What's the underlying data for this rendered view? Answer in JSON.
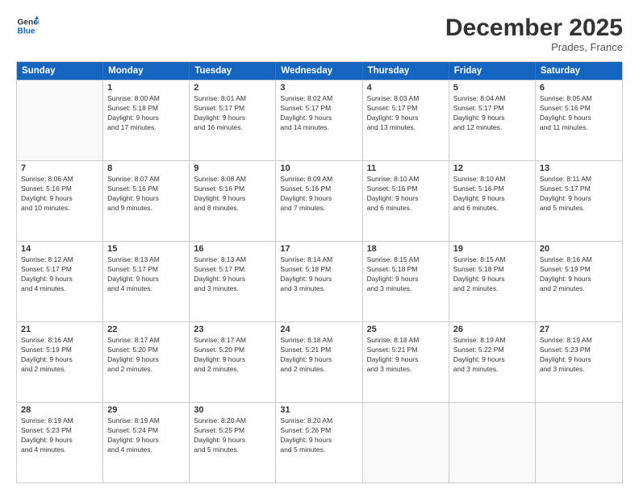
{
  "header": {
    "logo_line1": "General",
    "logo_line2": "Blue",
    "month": "December 2025",
    "location": "Prades, France"
  },
  "days_of_week": [
    "Sunday",
    "Monday",
    "Tuesday",
    "Wednesday",
    "Thursday",
    "Friday",
    "Saturday"
  ],
  "weeks": [
    [
      {
        "day": "",
        "info": ""
      },
      {
        "day": "1",
        "info": "Sunrise: 8:00 AM\nSunset: 5:18 PM\nDaylight: 9 hours\nand 17 minutes."
      },
      {
        "day": "2",
        "info": "Sunrise: 8:01 AM\nSunset: 5:17 PM\nDaylight: 9 hours\nand 16 minutes."
      },
      {
        "day": "3",
        "info": "Sunrise: 8:02 AM\nSunset: 5:17 PM\nDaylight: 9 hours\nand 14 minutes."
      },
      {
        "day": "4",
        "info": "Sunrise: 8:03 AM\nSunset: 5:17 PM\nDaylight: 9 hours\nand 13 minutes."
      },
      {
        "day": "5",
        "info": "Sunrise: 8:04 AM\nSunset: 5:17 PM\nDaylight: 9 hours\nand 12 minutes."
      },
      {
        "day": "6",
        "info": "Sunrise: 8:05 AM\nSunset: 5:16 PM\nDaylight: 9 hours\nand 11 minutes."
      }
    ],
    [
      {
        "day": "7",
        "info": "Sunrise: 8:06 AM\nSunset: 5:16 PM\nDaylight: 9 hours\nand 10 minutes."
      },
      {
        "day": "8",
        "info": "Sunrise: 8:07 AM\nSunset: 5:16 PM\nDaylight: 9 hours\nand 9 minutes."
      },
      {
        "day": "9",
        "info": "Sunrise: 8:08 AM\nSunset: 5:16 PM\nDaylight: 9 hours\nand 8 minutes."
      },
      {
        "day": "10",
        "info": "Sunrise: 8:09 AM\nSunset: 5:16 PM\nDaylight: 9 hours\nand 7 minutes."
      },
      {
        "day": "11",
        "info": "Sunrise: 8:10 AM\nSunset: 5:16 PM\nDaylight: 9 hours\nand 6 minutes."
      },
      {
        "day": "12",
        "info": "Sunrise: 8:10 AM\nSunset: 5:16 PM\nDaylight: 9 hours\nand 6 minutes."
      },
      {
        "day": "13",
        "info": "Sunrise: 8:11 AM\nSunset: 5:17 PM\nDaylight: 9 hours\nand 5 minutes."
      }
    ],
    [
      {
        "day": "14",
        "info": "Sunrise: 8:12 AM\nSunset: 5:17 PM\nDaylight: 9 hours\nand 4 minutes."
      },
      {
        "day": "15",
        "info": "Sunrise: 8:13 AM\nSunset: 5:17 PM\nDaylight: 9 hours\nand 4 minutes."
      },
      {
        "day": "16",
        "info": "Sunrise: 8:13 AM\nSunset: 5:17 PM\nDaylight: 9 hours\nand 3 minutes."
      },
      {
        "day": "17",
        "info": "Sunrise: 8:14 AM\nSunset: 5:18 PM\nDaylight: 9 hours\nand 3 minutes."
      },
      {
        "day": "18",
        "info": "Sunrise: 8:15 AM\nSunset: 5:18 PM\nDaylight: 9 hours\nand 3 minutes."
      },
      {
        "day": "19",
        "info": "Sunrise: 8:15 AM\nSunset: 5:18 PM\nDaylight: 9 hours\nand 2 minutes."
      },
      {
        "day": "20",
        "info": "Sunrise: 8:16 AM\nSunset: 5:19 PM\nDaylight: 9 hours\nand 2 minutes."
      }
    ],
    [
      {
        "day": "21",
        "info": "Sunrise: 8:16 AM\nSunset: 5:19 PM\nDaylight: 9 hours\nand 2 minutes."
      },
      {
        "day": "22",
        "info": "Sunrise: 8:17 AM\nSunset: 5:20 PM\nDaylight: 9 hours\nand 2 minutes."
      },
      {
        "day": "23",
        "info": "Sunrise: 8:17 AM\nSunset: 5:20 PM\nDaylight: 9 hours\nand 2 minutes."
      },
      {
        "day": "24",
        "info": "Sunrise: 8:18 AM\nSunset: 5:21 PM\nDaylight: 9 hours\nand 2 minutes."
      },
      {
        "day": "25",
        "info": "Sunrise: 8:18 AM\nSunset: 5:21 PM\nDaylight: 9 hours\nand 3 minutes."
      },
      {
        "day": "26",
        "info": "Sunrise: 8:19 AM\nSunset: 5:22 PM\nDaylight: 9 hours\nand 3 minutes."
      },
      {
        "day": "27",
        "info": "Sunrise: 8:19 AM\nSunset: 5:23 PM\nDaylight: 9 hours\nand 3 minutes."
      }
    ],
    [
      {
        "day": "28",
        "info": "Sunrise: 8:19 AM\nSunset: 5:23 PM\nDaylight: 9 hours\nand 4 minutes."
      },
      {
        "day": "29",
        "info": "Sunrise: 8:19 AM\nSunset: 5:24 PM\nDaylight: 9 hours\nand 4 minutes."
      },
      {
        "day": "30",
        "info": "Sunrise: 8:20 AM\nSunset: 5:25 PM\nDaylight: 9 hours\nand 5 minutes."
      },
      {
        "day": "31",
        "info": "Sunrise: 8:20 AM\nSunset: 5:26 PM\nDaylight: 9 hours\nand 5 minutes."
      },
      {
        "day": "",
        "info": ""
      },
      {
        "day": "",
        "info": ""
      },
      {
        "day": "",
        "info": ""
      }
    ]
  ]
}
